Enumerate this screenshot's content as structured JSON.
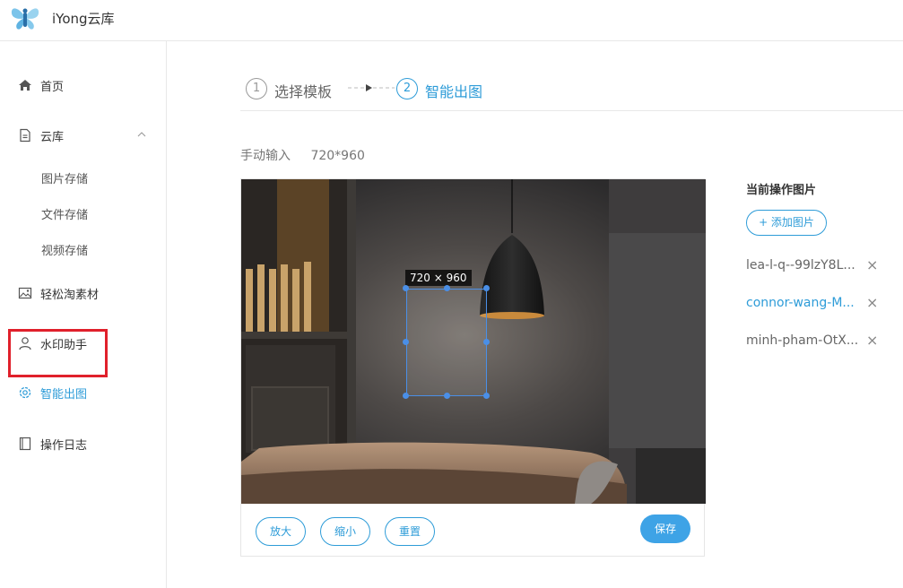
{
  "app": {
    "title": "iYong云库"
  },
  "sidebar": {
    "items": [
      {
        "label": "首页",
        "icon": "home-icon"
      },
      {
        "label": "云库",
        "icon": "document-icon"
      },
      {
        "label": "图片存储"
      },
      {
        "label": "文件存储"
      },
      {
        "label": "视频存储"
      },
      {
        "label": "轻松淘素材",
        "icon": "image-icon"
      },
      {
        "label": "水印助手",
        "icon": "user-icon"
      },
      {
        "label": "智能出图",
        "icon": "gear-icon"
      },
      {
        "label": "操作日志",
        "icon": "log-icon"
      }
    ]
  },
  "steps": [
    {
      "number": "1",
      "label": "选择模板"
    },
    {
      "number": "2",
      "label": "智能出图"
    }
  ],
  "size_row": {
    "label": "手动输入",
    "value": "720*960"
  },
  "crop": {
    "label": "720 × 960"
  },
  "toolbar": {
    "zoom_in": "放大",
    "zoom_out": "缩小",
    "reset": "重置",
    "save": "保存"
  },
  "panel": {
    "title": "当前操作图片",
    "add_label": "+ 添加图片",
    "files": [
      {
        "name": "lea-l-q--99lzY8L...",
        "remove": "×"
      },
      {
        "name": "connor-wang-M...",
        "remove": "×"
      },
      {
        "name": "minh-pham-OtX...",
        "remove": "×"
      }
    ]
  },
  "colors": {
    "accent": "#2e9cd8",
    "save_button": "#3ea3e6",
    "highlight": "#e0202b"
  }
}
